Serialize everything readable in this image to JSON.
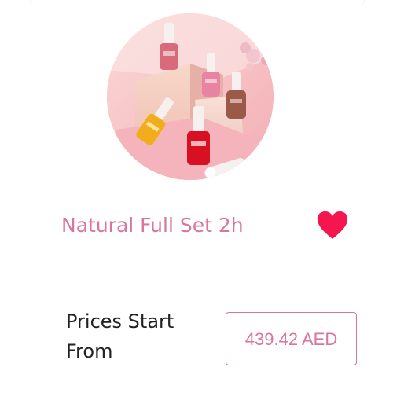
{
  "product": {
    "title": "Natural Full Set 2h",
    "image_icon": "nail-polish-bottles-image",
    "favorite_icon": "heart-icon",
    "favorite_color": "#f5164f"
  },
  "pricing": {
    "label": "Prices Start From",
    "price": "439.42 AED",
    "accent_color": "#d9769f"
  }
}
